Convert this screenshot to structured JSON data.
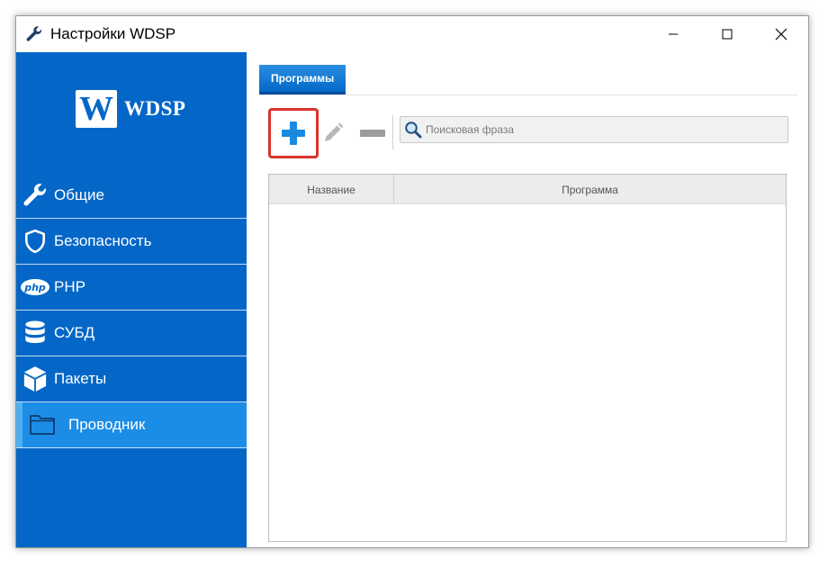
{
  "window": {
    "title": "Настройки WDSP"
  },
  "logo": {
    "letter": "W",
    "text": "WDSP"
  },
  "sidebar": {
    "items": [
      {
        "label": "Общие",
        "icon": "wrench-icon"
      },
      {
        "label": "Безопасность",
        "icon": "shield-icon"
      },
      {
        "label": "PHP",
        "icon": "php-icon",
        "icon_text": "php"
      },
      {
        "label": "СУБД",
        "icon": "database-icon"
      },
      {
        "label": "Пакеты",
        "icon": "package-icon"
      },
      {
        "label": "Проводник",
        "icon": "folder-icon",
        "active": true
      }
    ]
  },
  "tabs": [
    {
      "label": "Программы",
      "active": true
    }
  ],
  "toolbar": {
    "add": "plus-icon",
    "edit": "pencil-icon",
    "remove": "minus-icon"
  },
  "search": {
    "placeholder": "Поисковая фраза",
    "value": ""
  },
  "table": {
    "columns": [
      "Название",
      "Программа"
    ],
    "rows": []
  },
  "colors": {
    "sidebar": "#0467c8",
    "active_item": "#1c8de6",
    "add_icon": "#1a8ae0",
    "highlight": "#d9332b"
  }
}
